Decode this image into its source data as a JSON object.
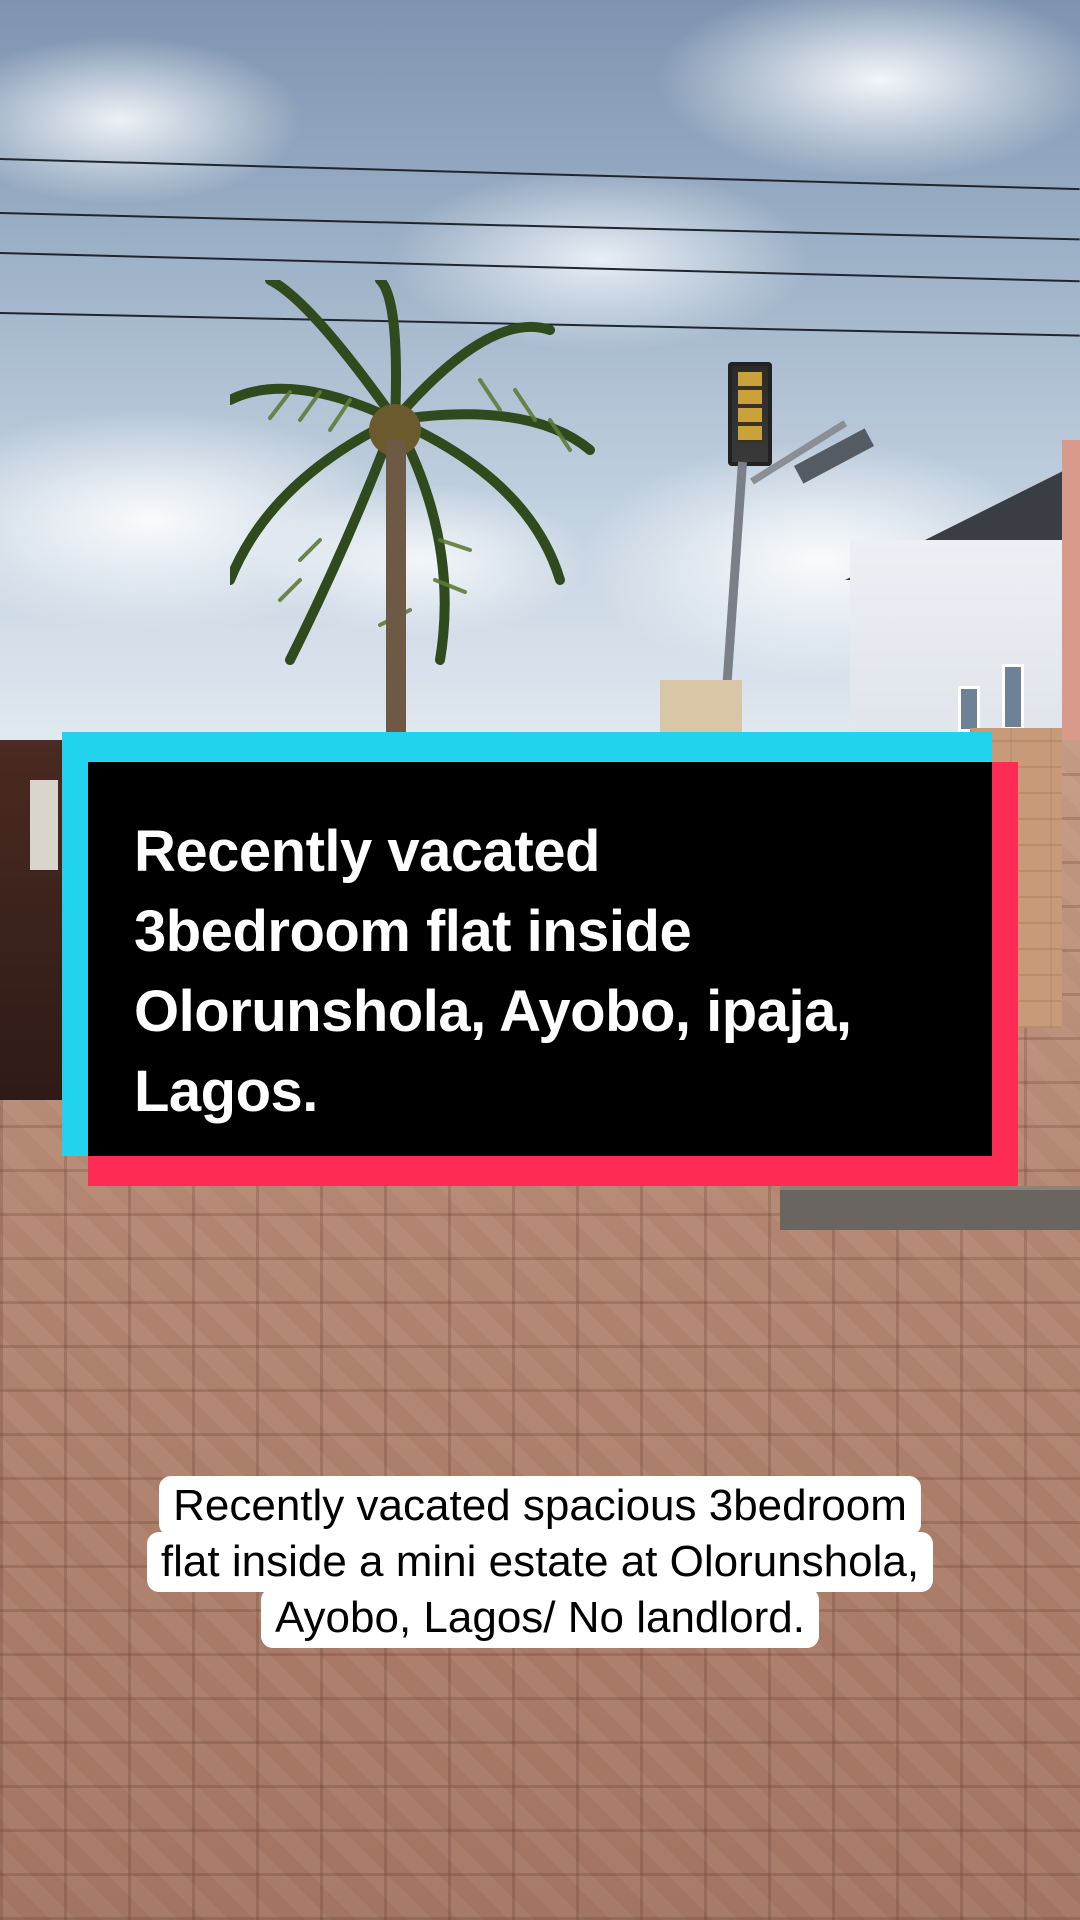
{
  "scene": {
    "description_icons": [
      "palm-tree-icon",
      "street-lamp-icon",
      "house-icon"
    ]
  },
  "title_card": {
    "text": "Recently vacated\n3bedroom flat inside\nOlorunshola, Ayobo, ipaja,\nLagos.",
    "colors": {
      "left_accent": "#22d3ee",
      "right_accent": "#fe2c55",
      "panel": "#000000",
      "text": "#ffffff"
    }
  },
  "caption": {
    "lines": [
      "Recently vacated spacious 3bedroom",
      "flat inside a mini estate at Olorunshola,",
      "Ayobo, Lagos/ No landlord."
    ]
  }
}
